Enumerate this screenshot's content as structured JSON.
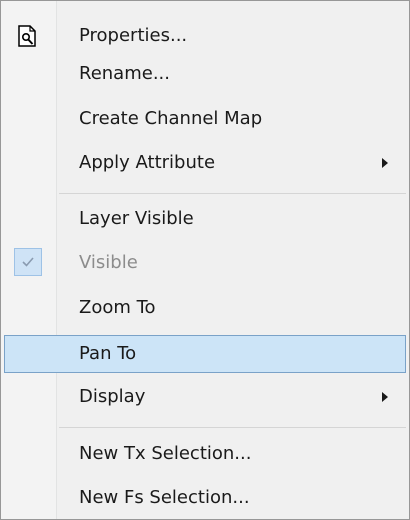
{
  "menu": {
    "items": [
      {
        "label": "Properties...",
        "icon": "properties-icon"
      },
      {
        "label": "Rename..."
      },
      {
        "label": "Create Channel Map"
      },
      {
        "label": "Apply Attribute",
        "submenu": true
      },
      {
        "label": "Layer Visible"
      },
      {
        "label": "Visible",
        "disabled": true,
        "checked": true
      },
      {
        "label": "Zoom To"
      },
      {
        "label": "Pan To",
        "highlighted": true
      },
      {
        "label": "Display",
        "submenu": true
      },
      {
        "label": "New Tx Selection..."
      },
      {
        "label": "New Fs Selection..."
      }
    ]
  },
  "colors": {
    "highlight_bg": "#cce4f7",
    "highlight_border": "#7aa2c8",
    "disabled_text": "#8c8c8c",
    "check_bg": "#cfe3f6"
  }
}
